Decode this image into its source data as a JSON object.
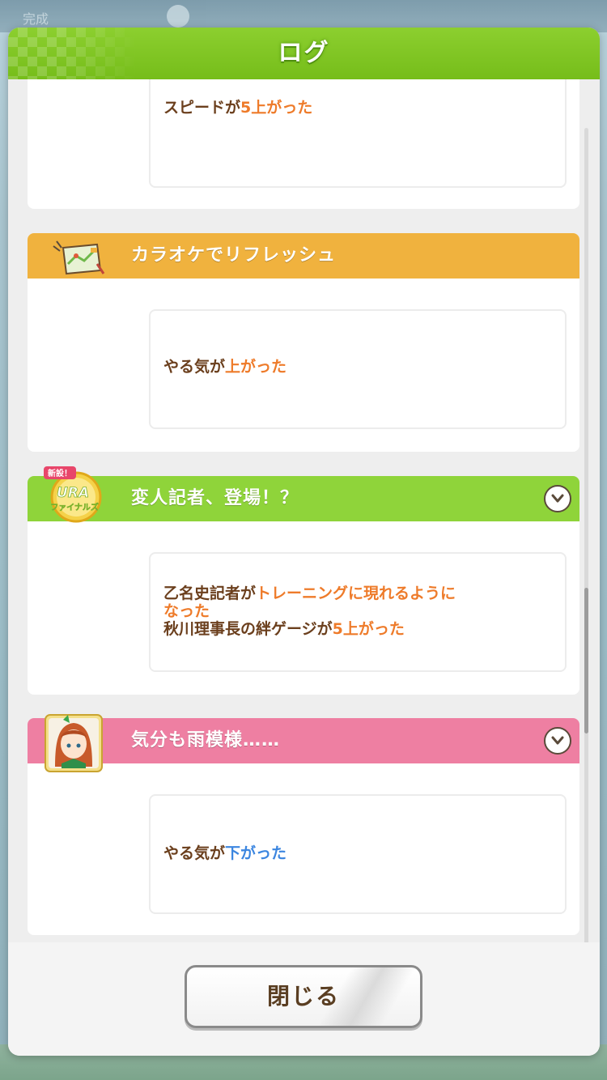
{
  "background": {
    "top_text": "完成"
  },
  "dialog": {
    "title": "ログ",
    "close_label": "閉じる"
  },
  "entries": [
    {
      "title": "",
      "header_color": "",
      "lines": [
        [
          {
            "text": "スピードが",
            "tone": "brown"
          },
          {
            "text": "5上がった",
            "tone": "orange"
          }
        ]
      ]
    },
    {
      "title": "カラオケでリフレッシュ",
      "header_color": "#f0b23e",
      "icon": "map-icon",
      "lines": [
        [
          {
            "text": "やる気が",
            "tone": "brown"
          },
          {
            "text": "上がった",
            "tone": "orange"
          }
        ]
      ]
    },
    {
      "title": "変人記者、登場！？",
      "header_color": "#8fd43a",
      "icon": "ura-finals-badge-icon",
      "badge_top": "新設！",
      "badge_main": "URA",
      "badge_sub": "ファイナルズ",
      "expandable": true,
      "lines": [
        [
          {
            "text": "乙名史記者が",
            "tone": "brown"
          },
          {
            "text": "トレーニングに現れるように",
            "tone": "orange"
          }
        ],
        [
          {
            "text": "なった",
            "tone": "orange"
          }
        ],
        [
          {
            "text": "秋川理事長の絆ゲージが",
            "tone": "brown"
          },
          {
            "text": "5上がった",
            "tone": "orange"
          }
        ]
      ]
    },
    {
      "title": "気分も雨模様……",
      "header_color": "#ee7fa2",
      "icon": "character-portrait-icon",
      "expandable": true,
      "lines": [
        [
          {
            "text": "やる気が",
            "tone": "brown"
          },
          {
            "text": "下がった",
            "tone": "blue"
          }
        ]
      ]
    },
    {
      "title": "",
      "header_color": "#4a8fe0"
    }
  ]
}
